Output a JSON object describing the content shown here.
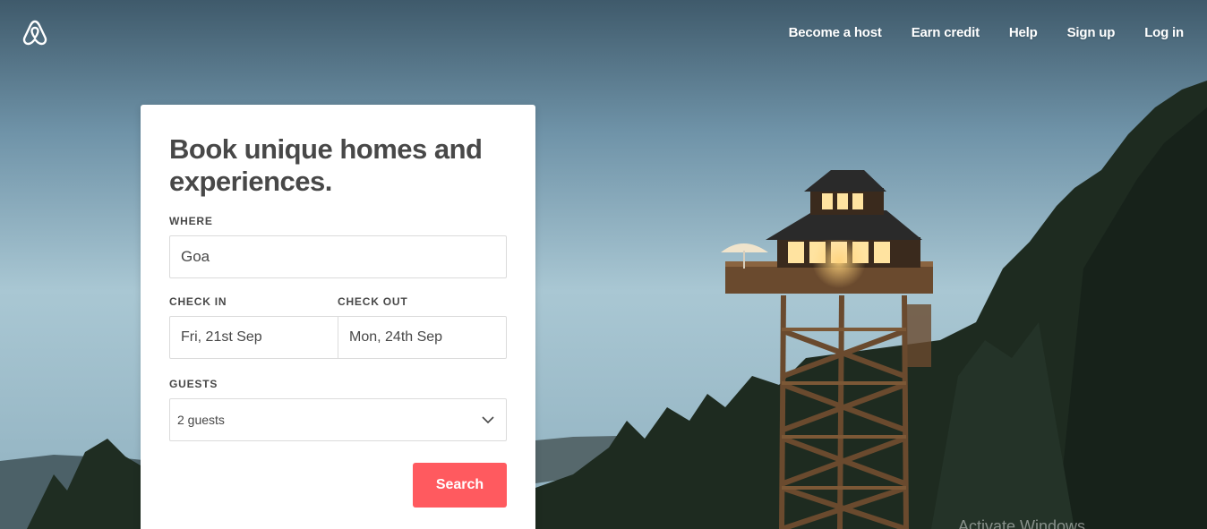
{
  "header": {
    "logo_icon": "airbnb-logo-icon",
    "nav": [
      "Become a host",
      "Earn credit",
      "Help",
      "Sign up",
      "Log in"
    ]
  },
  "card": {
    "title": "Book unique homes and experiences.",
    "where_label": "WHERE",
    "where_value": "Goa",
    "checkin_label": "CHECK IN",
    "checkout_label": "CHECK OUT",
    "checkin_value": "Fri, 21st Sep",
    "checkout_value": "Mon, 24th Sep",
    "guests_label": "GUESTS",
    "guests_value": "2 guests",
    "search_label": "Search"
  },
  "system": {
    "watermark": "Activate Windows"
  },
  "colors": {
    "brand": "#ff5a5f",
    "text": "#484848"
  }
}
